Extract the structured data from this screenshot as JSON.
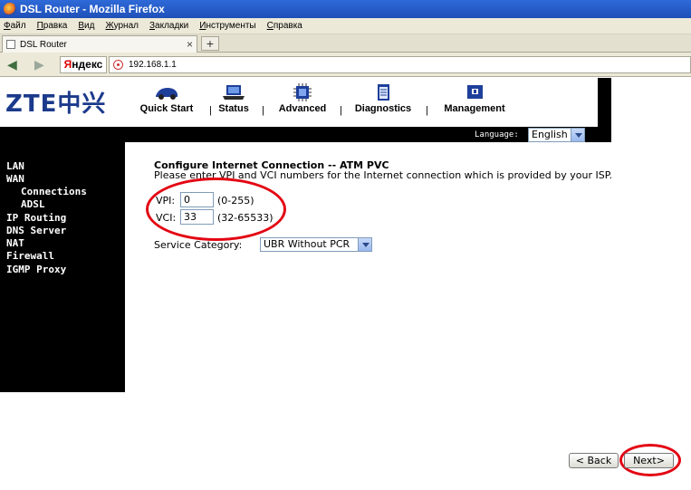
{
  "window": {
    "title": "DSL Router - Mozilla Firefox"
  },
  "menubar": [
    "Файл",
    "Правка",
    "Вид",
    "Журнал",
    "Закладки",
    "Инструменты",
    "Справка"
  ],
  "tab": {
    "title": "DSL Router",
    "close": "×",
    "new_tab": "+"
  },
  "navbar": {
    "back": "◀",
    "forward": "▶",
    "search_engine": "Яндекс",
    "url": "192.168.1.1"
  },
  "router": {
    "logo": "ZTE中兴",
    "nav": [
      {
        "label": "Quick Start",
        "icon": "car-icon"
      },
      {
        "label": "Status",
        "icon": "laptop-icon"
      },
      {
        "label": "Advanced",
        "icon": "chip-icon"
      },
      {
        "label": "Diagnostics",
        "icon": "clipboard-icon"
      },
      {
        "label": "Management",
        "icon": "book-icon"
      }
    ],
    "separator": "|",
    "language_label": "Language:",
    "language_value": "English"
  },
  "sidebar": {
    "items": [
      {
        "label": "LAN"
      },
      {
        "label": "WAN"
      },
      {
        "label": "Connections"
      },
      {
        "label": "ADSL"
      },
      {
        "label": "IP Routing"
      },
      {
        "label": "DNS Server"
      },
      {
        "label": "NAT"
      },
      {
        "label": "Firewall"
      },
      {
        "label": "IGMP Proxy"
      }
    ]
  },
  "form": {
    "title": "Configure Internet Connection -- ATM PVC",
    "description": "Please enter VPI and VCI numbers for the Internet connection which is provided by your ISP.",
    "vpi_label": "VPI:",
    "vpi_value": "0",
    "vpi_range": "(0-255)",
    "vci_label": "VCI:",
    "vci_value": "33",
    "vci_range": "(32-65533)",
    "service_label": "Service Category:",
    "service_value": "UBR Without PCR"
  },
  "buttons": {
    "back": "< Back",
    "next": "Next>"
  },
  "colors": {
    "accent_red": "#e30613",
    "brand_blue": "#1b3a8c"
  }
}
